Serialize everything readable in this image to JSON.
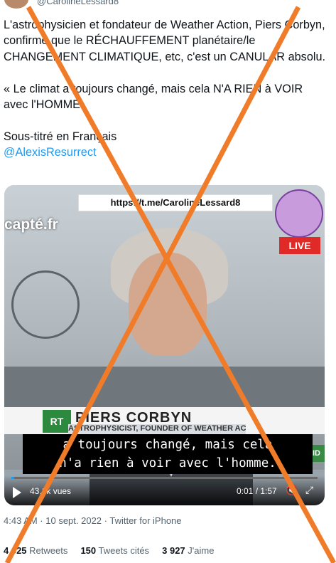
{
  "author": {
    "handle": "@CarolineLessard8"
  },
  "tweet": {
    "paragraph1": "L'astrophysicien et fondateur de Weather Action, Piers Corbyn, confirme que le RÉCHAUFFEMENT planétaire/le CHANGEMENT CLIMATIQUE, etc, c'est un CANULAR absolu.",
    "paragraph2": "« Le climat a toujours changé, mais cela N'A RIEN à VOIR avec l'HOMME",
    "paragraph3": "Sous-titré en Français",
    "mention": "@AlexisResurrect"
  },
  "video": {
    "url_banner": "https://t.me/CarolineLessard8",
    "watermark": "capté.fr",
    "live_badge": "LIVE",
    "channel_logo": "RT",
    "lower_third_name": "PIERS CORBYN",
    "lower_third_title": "ASTROPHYSICIST, FOUNDER OF WEATHER ACTION",
    "side_tag": "DID",
    "subtitle_line1": "a toujours changé, mais cela",
    "subtitle_line2": "n'a rien à voir avec l'homme.",
    "views": "43,1k vues",
    "time": "0:01 / 1:57",
    "progress_fraction": 0.01
  },
  "meta": {
    "timestamp": "4:43 AM · 10 sept. 2022 · Twitter for iPhone"
  },
  "stats": {
    "retweets_count": "4 025",
    "retweets_label": "Retweets",
    "quotes_count": "150",
    "quotes_label": "Tweets cités",
    "likes_count": "3 927",
    "likes_label": "J'aime"
  },
  "overlay": {
    "cross_color": "#f07c2a"
  }
}
